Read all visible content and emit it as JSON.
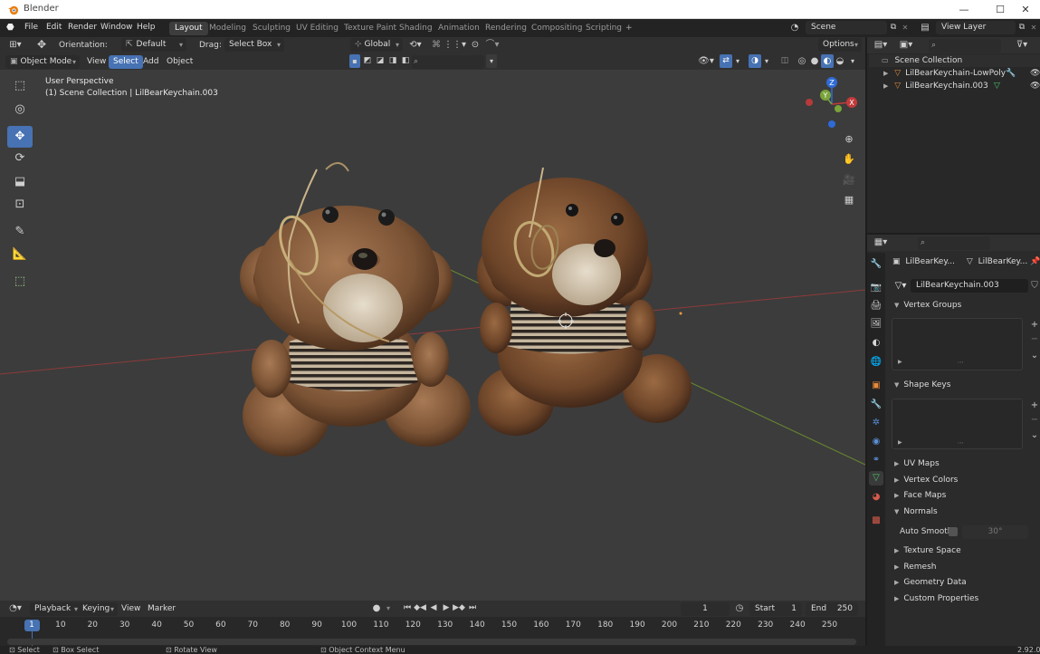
{
  "window": {
    "title": "Blender",
    "minimize": "—",
    "maximize": "☐",
    "close": "✕"
  },
  "menu": {
    "items": [
      "File",
      "Edit",
      "Render",
      "Window",
      "Help"
    ]
  },
  "workspaces": {
    "tabs": [
      "Layout",
      "Modeling",
      "Sculpting",
      "UV Editing",
      "Texture Paint",
      "Shading",
      "Animation",
      "Rendering",
      "Compositing",
      "Scripting"
    ],
    "active": "Layout",
    "add": "+"
  },
  "scene": {
    "name": "Scene",
    "view_layer": "View Layer"
  },
  "tool_header": {
    "orientation_label": "Orientation:",
    "orientation_value": "Default",
    "drag_label": "Drag:",
    "drag_value": "Select Box",
    "transform_orientation": "Global",
    "options": "Options"
  },
  "view_header": {
    "mode": "Object Mode",
    "menus": [
      "View",
      "Select",
      "Add",
      "Object"
    ],
    "active_menu": "Select"
  },
  "viewport": {
    "perspective": "User Perspective",
    "collection_info": "(1) Scene Collection | LilBearKeychain.003",
    "gizmo": {
      "x": "X",
      "y": "Y",
      "z": "Z"
    }
  },
  "timeline": {
    "menus": [
      "Playback",
      "Keying",
      "View",
      "Marker"
    ],
    "current_frame": "1",
    "start_label": "Start",
    "start": "1",
    "end_label": "End",
    "end": "250",
    "ticks": [
      "1",
      "10",
      "20",
      "30",
      "40",
      "50",
      "60",
      "70",
      "80",
      "90",
      "100",
      "110",
      "120",
      "130",
      "140",
      "150",
      "160",
      "170",
      "180",
      "190",
      "200",
      "210",
      "220",
      "230",
      "240",
      "250"
    ]
  },
  "statusbar": {
    "items": [
      "Select",
      "Box Select",
      "Rotate View",
      "Object Context Menu"
    ],
    "version": "2.92.0"
  },
  "outliner": {
    "root": "Scene Collection",
    "objects": [
      {
        "name": "LilBearKeychain-LowPoly"
      },
      {
        "name": "LilBearKeychain.003"
      }
    ]
  },
  "properties": {
    "breadcrumb_object": "LilBearKey...",
    "breadcrumb_mesh": "LilBearKey...",
    "mesh_name": "LilBearKeychain.003",
    "sections": {
      "vertex_groups": "Vertex Groups",
      "shape_keys": "Shape Keys",
      "uv_maps": "UV Maps",
      "vertex_colors": "Vertex Colors",
      "face_maps": "Face Maps",
      "normals": "Normals",
      "texture_space": "Texture Space",
      "remesh": "Remesh",
      "geometry_data": "Geometry Data",
      "custom_properties": "Custom Properties"
    },
    "auto_smooth_label": "Auto Smooth",
    "auto_smooth_angle": "30°"
  },
  "colors": {
    "accent": "#4772b3",
    "x_axis": "#c33a3a",
    "y_axis": "#7aa33a",
    "z_axis": "#2f6bd6"
  }
}
